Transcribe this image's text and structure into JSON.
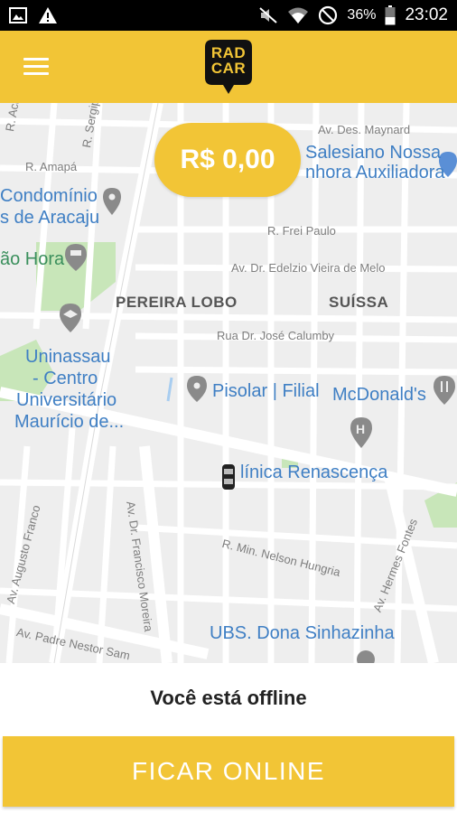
{
  "status_bar": {
    "icons": [
      "image-icon",
      "warning-icon",
      "mute-icon",
      "wifi-icon",
      "no-disturb-icon",
      "battery-icon"
    ],
    "battery": "36%",
    "time": "23:02"
  },
  "app_bar": {
    "logo_line1": "RAD",
    "logo_line2": "CAR",
    "menu_icon": "hamburger-icon"
  },
  "map": {
    "fare": "R$ 0,00",
    "streets": {
      "r_acre": "R. Acre",
      "r_sergipe": "R. Sergipe",
      "r_amapa": "R. Amapá",
      "av_des_maynard": "Av. Des. Maynard",
      "r_frei_paulo": "R. Frei Paulo",
      "av_edelzio": "Av. Dr. Edelzio Vieira de Melo",
      "rua_jose_calumby": "Rua Dr. José Calumby",
      "av_augusto_franco": "Av. Augusto Franco",
      "av_francisco_moreira": "Av. Dr. Francisco Moreira",
      "r_nelson_hungria": "R. Min. Nelson Hungria",
      "av_hermes_fontes": "Av. Hermes Fontes",
      "av_padre_nestor": "Av. Padre Nestor Sam"
    },
    "neighborhoods": {
      "pereira_lobo": "PEREIRA LOBO",
      "suissa": "SUÍSSA"
    },
    "pois": {
      "salesiano_1": "Salesiano Nossa",
      "salesiano_2": "nhora Auxiliadora",
      "condominio_1": "Condomínio",
      "condominio_2": "s de Aracaju",
      "hora": "ão Hora",
      "uninassau_1": "Uninassau",
      "uninassau_2": "- Centro",
      "uninassau_3": "Universitário",
      "uninassau_4": "Maurício de...",
      "pisolar": "Pisolar | Filial",
      "mcdonalds": "McDonald's",
      "renascenca": "línica Renascença",
      "ubs": "UBS. Dona Sinhazinha"
    }
  },
  "bottom": {
    "status_text": "Você está offline",
    "go_online_label": "FICAR ONLINE"
  }
}
